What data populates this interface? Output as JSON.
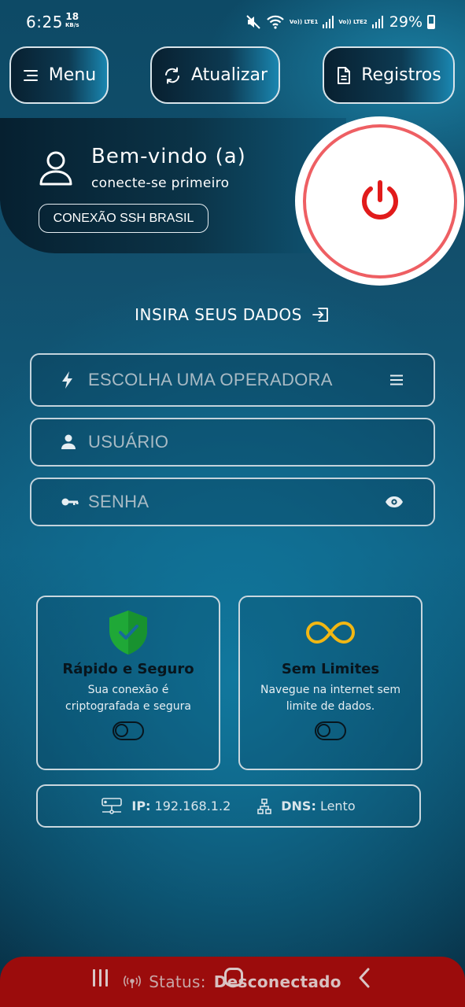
{
  "statusbar": {
    "time": "6:25",
    "net_speed": "18",
    "net_unit": "KB/s",
    "sim1": "Vo)) LTE1",
    "sim2": "Vo)) LTE2",
    "battery": "29%"
  },
  "toolbar": {
    "menu_label": "Menu",
    "refresh_label": "Atualizar",
    "logs_label": "Registros"
  },
  "welcome": {
    "title": "Bem-vindo (a)",
    "subtitle": "conecte-se primeiro",
    "badge": "CONEXÃO SSH BRASIL"
  },
  "power": {
    "color": "#e11b1b",
    "ring_color": "#ee5f63"
  },
  "form": {
    "title": "INSIRA SEUS DADOS",
    "operator_placeholder": "ESCOLHA UMA OPERADORA",
    "user_placeholder": "USUÁRIO",
    "password_placeholder": "SENHA"
  },
  "features": [
    {
      "title": "Rápido e Seguro",
      "desc": "Sua conexão é criptografada e segura",
      "icon": "shield-check-icon",
      "enabled": false
    },
    {
      "title": "Sem Limites",
      "desc": "Navegue na internet sem limite de dados.",
      "icon": "infinity-icon",
      "enabled": false
    }
  ],
  "network": {
    "ip_label": "IP:",
    "ip_value": "192.168.1.2",
    "dns_label": "DNS:",
    "dns_value": "Lento"
  },
  "status": {
    "label": "Status:",
    "value": "Desconectado",
    "color": "#9b0c0c"
  }
}
